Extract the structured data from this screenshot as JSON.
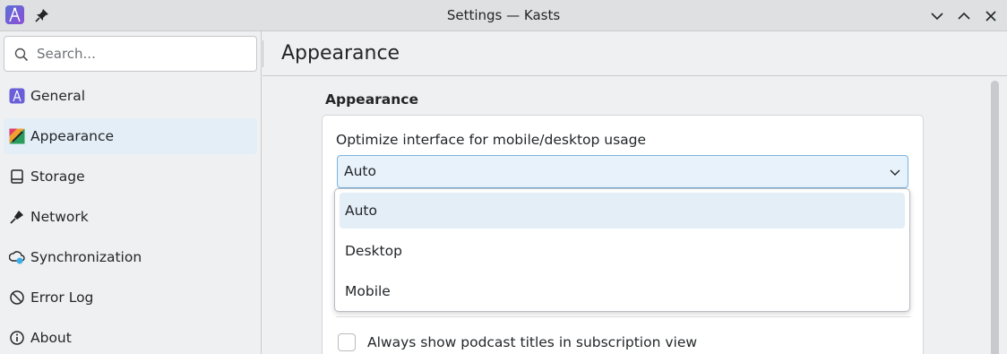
{
  "window": {
    "title": "Settings — Kasts",
    "icons": [
      "kasts-app-icon",
      "pin-icon",
      "minimize-icon",
      "maximize-icon",
      "close-icon"
    ]
  },
  "sidebar": {
    "search_placeholder": "Search...",
    "items": [
      {
        "label": "General",
        "icon": "kasts-icon"
      },
      {
        "label": "Appearance",
        "icon": "appearance-icon"
      },
      {
        "label": "Storage",
        "icon": "storage-icon"
      },
      {
        "label": "Network",
        "icon": "network-icon"
      },
      {
        "label": "Synchronization",
        "icon": "sync-icon"
      },
      {
        "label": "Error Log",
        "icon": "error-log-icon"
      },
      {
        "label": "About",
        "icon": "info-icon"
      }
    ],
    "active": "Appearance"
  },
  "header": {
    "title": "Appearance"
  },
  "main": {
    "section_title": "Appearance",
    "interface_label": "Optimize interface for mobile/desktop usage",
    "interface_value": "Auto",
    "options": [
      "Auto",
      "Desktop",
      "Mobile"
    ],
    "checkbox_label": "Always show podcast titles in subscription view"
  },
  "colors": {
    "accent": "#3daee9",
    "selection": "#e4eef7",
    "window_bg": "#eff0f1"
  }
}
